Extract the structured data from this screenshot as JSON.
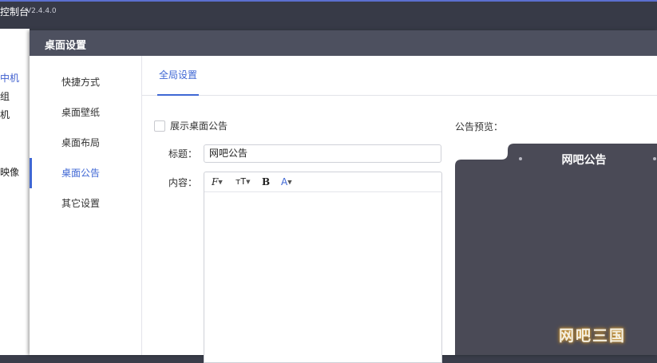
{
  "app": {
    "title": "控制台",
    "version": "V2.4.4.0",
    "left_items": [
      "中机",
      "组",
      "机",
      "映像"
    ]
  },
  "dialog": {
    "title": "桌面设置",
    "nav": [
      {
        "label": "快捷方式",
        "active": false
      },
      {
        "label": "桌面壁纸",
        "active": false
      },
      {
        "label": "桌面布局",
        "active": false
      },
      {
        "label": "桌面公告",
        "active": true
      },
      {
        "label": "其它设置",
        "active": false
      }
    ],
    "tab": "全局设置",
    "form": {
      "show_notice_label": "展示桌面公告",
      "show_notice_checked": false,
      "title_label": "标题：",
      "title_value": "网吧公告",
      "content_label": "内容：",
      "toolbar": {
        "font": "F",
        "size": "тT",
        "bold": "B",
        "color": "A"
      }
    },
    "preview": {
      "label": "公告预览：",
      "notice_title": "网吧公告"
    }
  },
  "watermark": "网吧三国",
  "colors": {
    "accent": "#3f67d4",
    "dialog_header": "#4d505f",
    "preview_bg": "#4a4a56"
  }
}
